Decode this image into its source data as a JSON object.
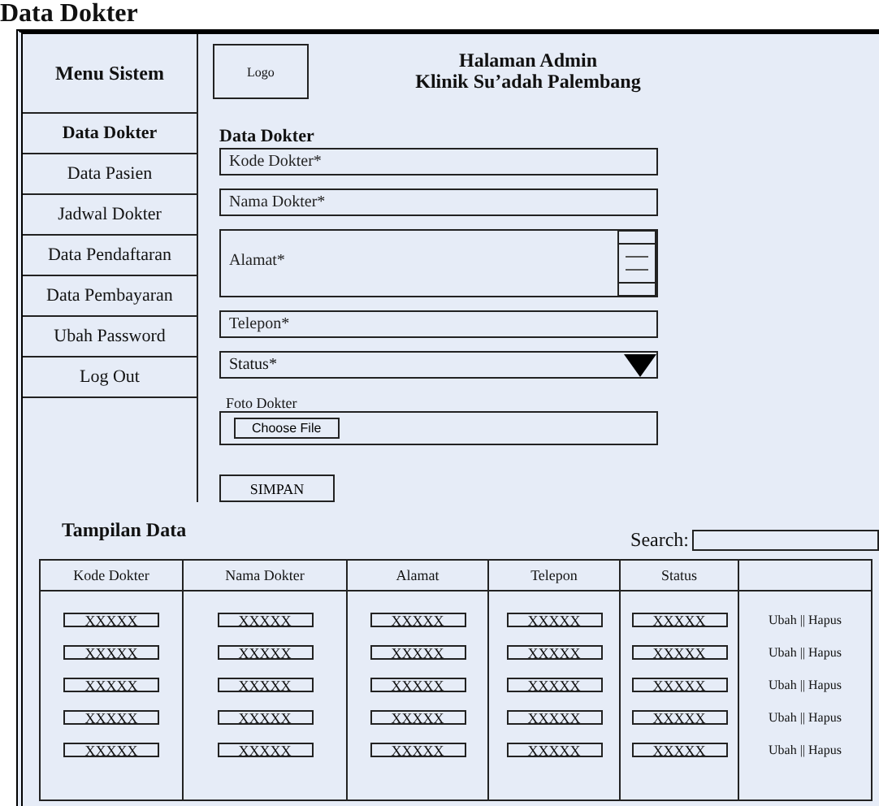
{
  "page_title": "Data Dokter",
  "sidebar": {
    "title": "Menu Sistem",
    "items": [
      {
        "label": "Data Dokter",
        "selected": true
      },
      {
        "label": "Data Pasien",
        "selected": false
      },
      {
        "label": "Jadwal Dokter",
        "selected": false
      },
      {
        "label": "Data Pendaftaran",
        "selected": false
      },
      {
        "label": "Data Pembayaran",
        "selected": false
      },
      {
        "label": "Ubah Password",
        "selected": false
      },
      {
        "label": "Log Out",
        "selected": false
      }
    ]
  },
  "header": {
    "logo": "Logo",
    "title_lines": [
      "Halaman Admin",
      "Klinik Su’adah Palembang"
    ]
  },
  "form": {
    "title": "Data Dokter",
    "fields": [
      {
        "kind": "text",
        "placeholder": "Kode Dokter*"
      },
      {
        "kind": "text",
        "placeholder": "Nama Dokter*"
      },
      {
        "kind": "textarea",
        "placeholder": "Alamat*"
      },
      {
        "kind": "text",
        "placeholder": "Telepon*"
      },
      {
        "kind": "select",
        "placeholder": "Status*"
      },
      {
        "kind": "file",
        "label": "Foto Dokter",
        "button": "Choose File"
      }
    ],
    "submit": "SIMPAN"
  },
  "table_section": {
    "title": "Tampilan Data",
    "search_label": "Search:",
    "columns": [
      "Kode Dokter",
      "Nama Dokter",
      "Alamat",
      "Telepon",
      "Status"
    ],
    "rows": [
      {
        "cells": [
          "XXXXX",
          "XXXXX",
          "XXXXX",
          "XXXXX",
          "XXXXX"
        ],
        "actions": "Ubah || Hapus"
      },
      {
        "cells": [
          "XXXXX",
          "XXXXX",
          "XXXXX",
          "XXXXX",
          "XXXXX"
        ],
        "actions": "Ubah || Hapus"
      },
      {
        "cells": [
          "XXXXX",
          "XXXXX",
          "XXXXX",
          "XXXXX",
          "XXXXX"
        ],
        "actions": "Ubah || Hapus"
      },
      {
        "cells": [
          "XXXXX",
          "XXXXX",
          "XXXXX",
          "XXXXX",
          "XXXXX"
        ],
        "actions": "Ubah || Hapus"
      },
      {
        "cells": [
          "XXXXX",
          "XXXXX",
          "XXXXX",
          "XXXXX",
          "XXXXX"
        ],
        "actions": "Ubah || Hapus"
      }
    ]
  }
}
